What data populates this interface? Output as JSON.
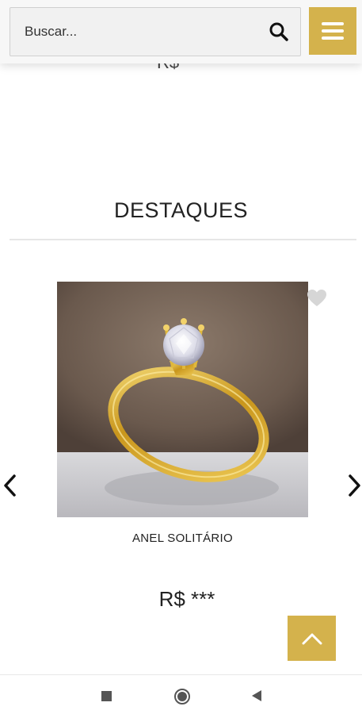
{
  "header": {
    "search_placeholder": "Buscar...",
    "search_icon": "search-icon",
    "menu_icon": "hamburger-menu-icon"
  },
  "previous_product": {
    "price_fragment": "R$"
  },
  "section": {
    "title": "DESTAQUES"
  },
  "product": {
    "name": "ANEL SOLITÁRIO",
    "price": "R$ ***",
    "image_alt": "gold solitaire ring with diamond",
    "wishlist_icon": "heart-icon"
  },
  "carousel": {
    "prev_icon": "chevron-left-icon",
    "next_icon": "chevron-right-icon"
  },
  "back_to_top_icon": "chevron-up-icon",
  "colors": {
    "accent": "#d4b24c",
    "header_bg": "#f7f7f7",
    "text": "#222222"
  },
  "system_nav": {
    "recent_icon": "square-icon",
    "home_icon": "circle-icon",
    "back_icon": "triangle-back-icon"
  }
}
